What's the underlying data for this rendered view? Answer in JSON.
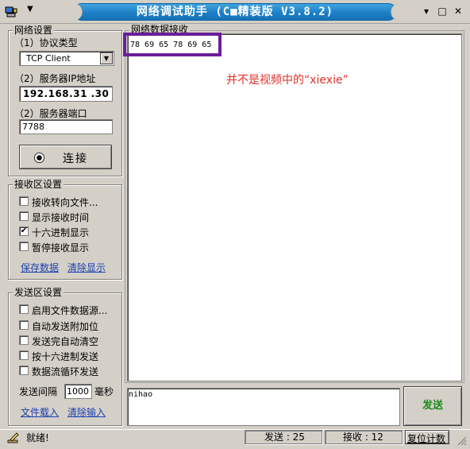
{
  "window": {
    "title": "网络调试助手 (C■精装版 V3.8.2)",
    "minimize_glyph": "▾",
    "maximize_glyph": "□",
    "close_glyph": "✕",
    "caret_glyph": "▼"
  },
  "network_settings": {
    "group_title": "网络设置",
    "protocol_label": "（1）协议类型",
    "protocol_value": "TCP Client",
    "ip_label": "（2）服务器IP地址",
    "ip_value": "192.168.31 .30",
    "port_label": "（2）服务器端口",
    "port_value": "7788",
    "connect_label": "连接"
  },
  "receive_settings": {
    "group_title": "接收区设置",
    "options": [
      {
        "label": "接收转向文件...",
        "checked": false
      },
      {
        "label": "显示接收时间",
        "checked": false
      },
      {
        "label": "十六进制显示",
        "checked": true
      },
      {
        "label": "暂停接收显示",
        "checked": false
      }
    ],
    "save_link": "保存数据",
    "clear_link": "清除显示"
  },
  "send_settings": {
    "group_title": "发送区设置",
    "options": [
      {
        "label": "启用文件数据源...",
        "checked": false
      },
      {
        "label": "自动发送附加位",
        "checked": false
      },
      {
        "label": "发送完自动清空",
        "checked": false
      },
      {
        "label": "按十六进制发送",
        "checked": false
      },
      {
        "label": "数据流循环发送",
        "checked": false
      }
    ],
    "interval_label": "发送间隔",
    "interval_value": "1000",
    "interval_unit": "毫秒",
    "load_file_link": "文件载入",
    "clear_input_link": "清除输入"
  },
  "receive_area": {
    "group_title": "网络数据接收",
    "hex_data": "78 69 65 78 69 65",
    "annotation": "并不是视频中的“xiexie”"
  },
  "send_area": {
    "text": "nihao",
    "send_button": "发送"
  },
  "status": {
    "ready": "就绪!",
    "send_count": "发送 : 25",
    "recv_count": "接收 : 12",
    "reset_button": "复位计数"
  },
  "colors": {
    "title_blue": "#1e7fc6",
    "annotation_red": "#e0302a",
    "highlight_purple": "#6a1d9a",
    "send_green": "#1a8a1a",
    "link_blue": "#1a3fb0"
  }
}
